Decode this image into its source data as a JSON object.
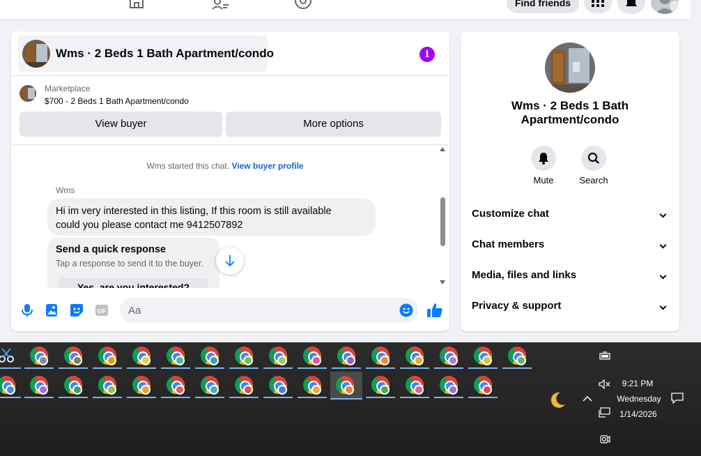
{
  "topbar": {
    "find_friends": "Find friends",
    "icons": [
      "home-icon",
      "friends-icon",
      "groups-icon",
      "menu-grid-icon",
      "notifications-icon",
      "account-icon"
    ]
  },
  "chat": {
    "title": "Wms · 2 Beds 1 Bath Apartment/condo",
    "marketplace_label": "Marketplace",
    "listing": "$700 - 2 Beds 1 Bath Apartment/condo",
    "view_buyer": "View buyer",
    "more_options": "More options",
    "system_note": "Wms started this chat.",
    "system_link": "View buyer profile",
    "sender": "Wms",
    "message_line1": "Hi im very interested in this listing, If this room is still available",
    "message_line2": "could you please contact me 9412507892",
    "quick_title": "Send a quick response",
    "quick_sub": "Tap a response to send it to the buyer.",
    "quick_option": "Yes, are you interested?",
    "input_placeholder": "Aa"
  },
  "side": {
    "title_line1": "Wms · 2 Beds 1 Bath",
    "title_line2": "Apartment/condo",
    "mute": "Mute",
    "search": "Search",
    "rows": [
      "Customize chat",
      "Chat members",
      "Media, files and links",
      "Privacy & support"
    ]
  },
  "taskbar": {
    "time": "9:21 PM",
    "day": "Wednesday",
    "date": "1/14/2026"
  },
  "colors": {
    "accent_blue": "#0a7cff",
    "info_purple": "#a200ff",
    "link_blue": "#1861d5"
  }
}
